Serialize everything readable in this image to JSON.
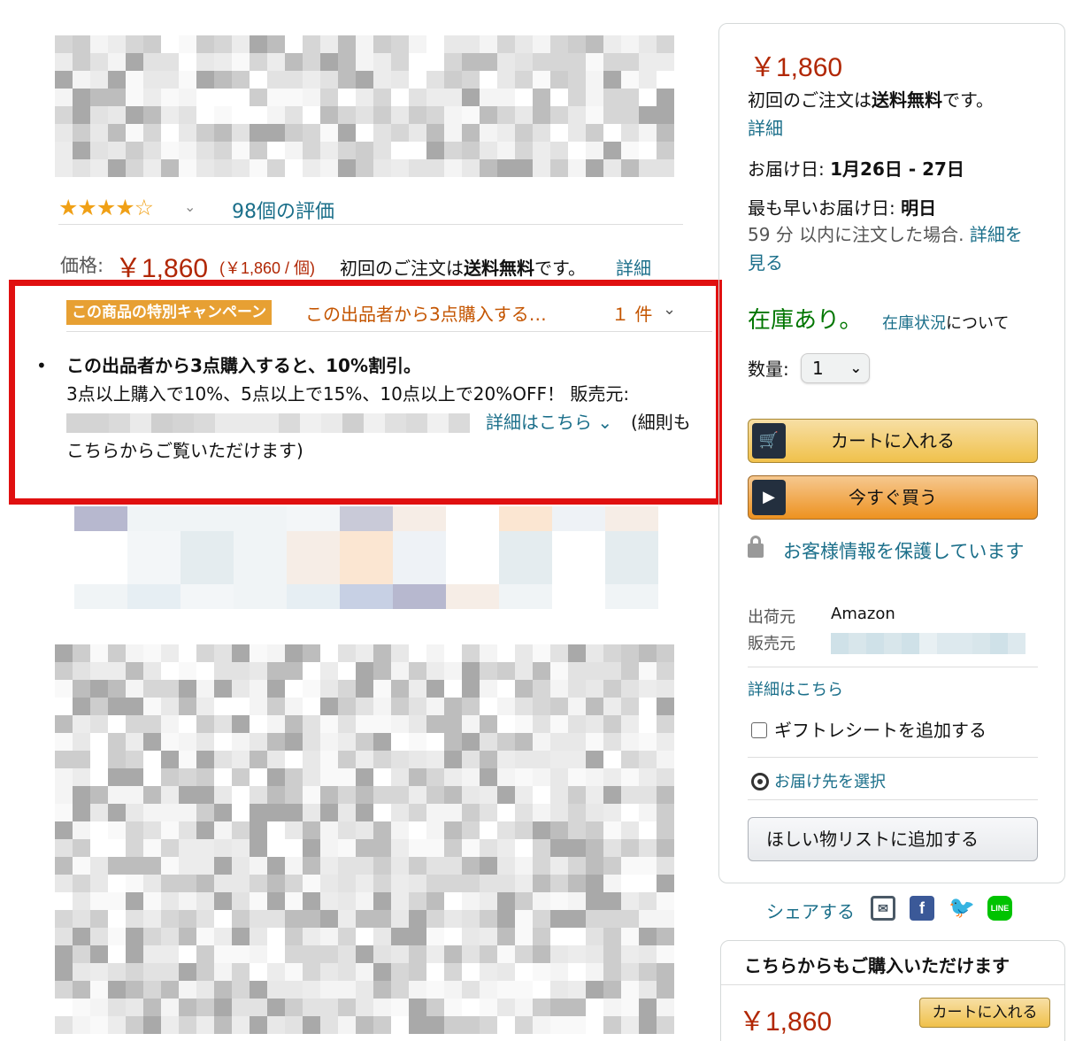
{
  "product": {
    "rating_stars": "★★★★☆",
    "rating_chevron": "⌄",
    "rating_count": "98個の評価",
    "price_label": "価格:",
    "price": "￥1,860",
    "price_unit": "(￥1,860 / 個)",
    "shipping_prefix": "初回のご注文は",
    "shipping_bold": "送料無料",
    "shipping_suffix": "です。",
    "shipping_detail": "詳細"
  },
  "campaign": {
    "badge": "この商品の特別キャンペーン",
    "title": "この出品者から3点購入する…",
    "count": "１ 件",
    "chevron": "⌄",
    "bullet": "•",
    "headline": "この出品者から3点購入すると、10%割引。",
    "description": "3点以上購入で10%、5点以上で15%、10点以上で20%OFF！ 販売元:",
    "details_link": "詳細はこちら ⌄",
    "details_suffix": "(細則も",
    "details_line2": "こちらからご覧いただけます)"
  },
  "buybox": {
    "price": "￥1,860",
    "ship_prefix": "初回のご注文は",
    "ship_bold": "送料無料",
    "ship_suffix": "です。",
    "ship_detail": "詳細",
    "delivery_label": "お届け日: ",
    "delivery_date": "1月26日 - 27日",
    "fastest_label": "最も早いお届け日: ",
    "fastest_date": "明日",
    "fastest_cond": "59 分 以内に注文した場合.",
    "fastest_link": "詳細を見る",
    "stock": "在庫あり。",
    "stock_link": "在庫状況",
    "stock_suffix": "について",
    "qty_label": "数量:",
    "qty_value": "1",
    "qty_chevron": "⌄",
    "add_to_cart": "カートに入れる",
    "buy_now": "今すぐ買う",
    "cart_icon": "🛒",
    "play_icon": "▶",
    "secure": "お客様情報を保護しています",
    "ship_from_label": "出荷元",
    "ship_from_value": "Amazon",
    "seller_label": "販売元",
    "details_here": "詳細はこちら",
    "gift_receipt": "ギフトレシートを追加する",
    "select_address": "お届け先を選択",
    "wishlist": "ほしい物リストに追加する"
  },
  "share": {
    "label": "シェアする",
    "mail_icon": "✉",
    "facebook_icon": "f",
    "twitter_icon": "🐦",
    "line_icon": "LINE"
  },
  "other_sellers": {
    "title": "こちらからもご購入いただけます",
    "price": "￥1,860",
    "add_to_cart": "カートに入れる"
  },
  "colors": {
    "price_red": "#b12704",
    "link_teal": "#1b6f8a",
    "stock_green": "#007600",
    "campaign_orange": "#c45500",
    "badge_bg": "#e7a033",
    "highlight_border": "#e01010"
  }
}
